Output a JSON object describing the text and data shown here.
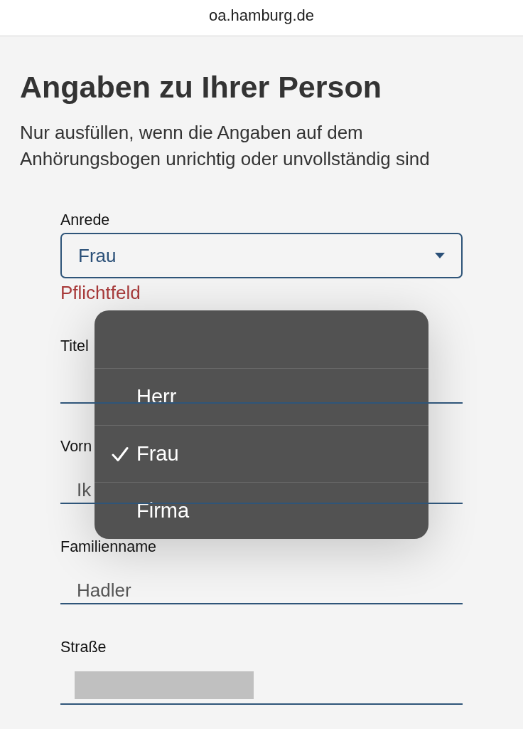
{
  "browser": {
    "url": "oa.hamburg.de"
  },
  "page": {
    "title": "Angaben zu Ihrer Person",
    "subtitle": "Nur ausfüllen, wenn die Angaben auf dem Anhörungsbogen unrichtig oder unvollständig sind"
  },
  "form": {
    "fields": [
      {
        "kind": "select",
        "label": "Anrede",
        "value": "Frau",
        "error": "Pflichtfeld",
        "expanded": true,
        "options": [
          {
            "selected": false
          },
          {
            "label": "Herr",
            "selected": false
          },
          {
            "label": "Frau",
            "selected": true
          },
          {
            "label": "Firma",
            "selected": false
          }
        ]
      },
      {
        "kind": "text",
        "label": "Titel"
      },
      {
        "kind": "text",
        "label": "Vorn",
        "value": "Ik"
      },
      {
        "kind": "text",
        "label": "Familienname",
        "value": "Hadler"
      },
      {
        "kind": "text",
        "label": "Straße",
        "redacted": true
      }
    ]
  }
}
